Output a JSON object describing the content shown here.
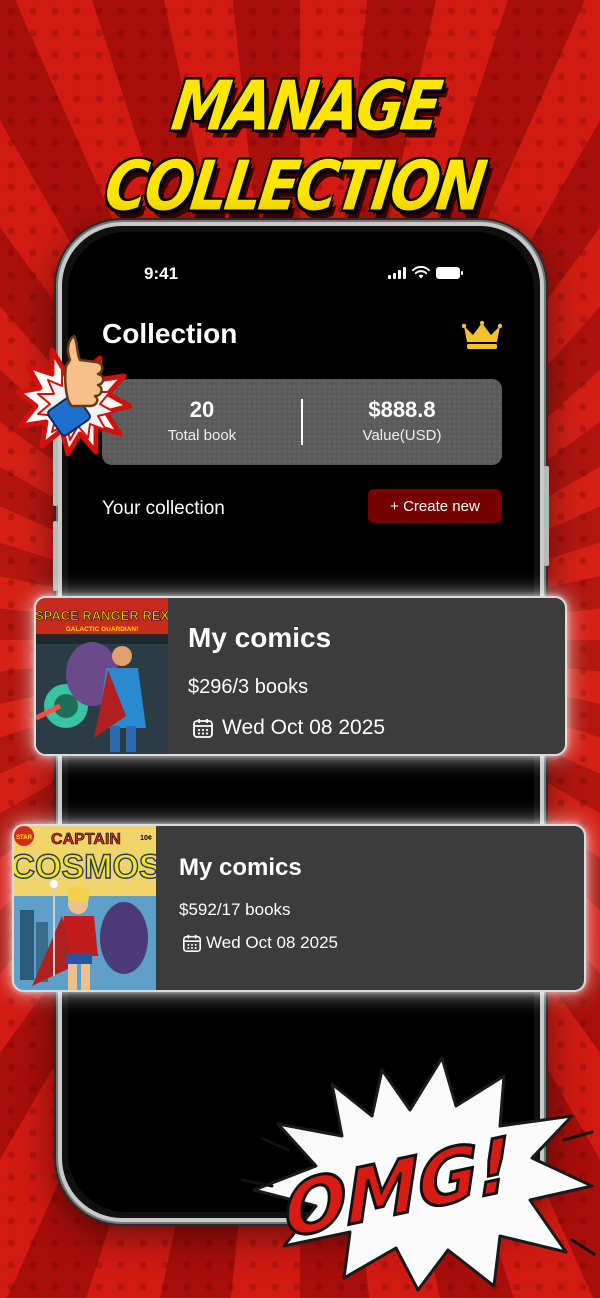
{
  "headline": "MANAGE COLLECTION",
  "status_bar": {
    "time": "9:41"
  },
  "screen": {
    "title": "Collection",
    "stats": {
      "total_books": {
        "value": "20",
        "label": "Total book"
      },
      "value_usd": {
        "value": "$888.8",
        "label": "Value(USD)"
      }
    },
    "section_label": "Your collection",
    "create_button_label": "+ Create new"
  },
  "collections": [
    {
      "name": "My comics",
      "price_books": "$296/3 books",
      "date": "Wed Oct 08 2025",
      "cover": {
        "title": "SPACE RANGER REX",
        "subtitle": "GALACTIC GUARDIAN!"
      }
    },
    {
      "name": "My comics",
      "price_books": "$592/17 books",
      "date": "Wed Oct 08 2025",
      "cover": {
        "badge": "STAR",
        "title_top": "CAPTAIN",
        "title_main": "COSMOS",
        "price_tag": "10¢"
      }
    }
  ],
  "sticker_text": "OMG!",
  "icons": [
    "crown-icon",
    "calendar-icon",
    "signal-icon",
    "wifi-icon",
    "battery-icon",
    "thumbs-up-sticker"
  ],
  "colors": {
    "background_red": "#c3140f",
    "headline_yellow": "#ffe600",
    "create_button": "#760000",
    "card_bg": "#3c3c3c",
    "crown_gold": "#f2c230"
  }
}
